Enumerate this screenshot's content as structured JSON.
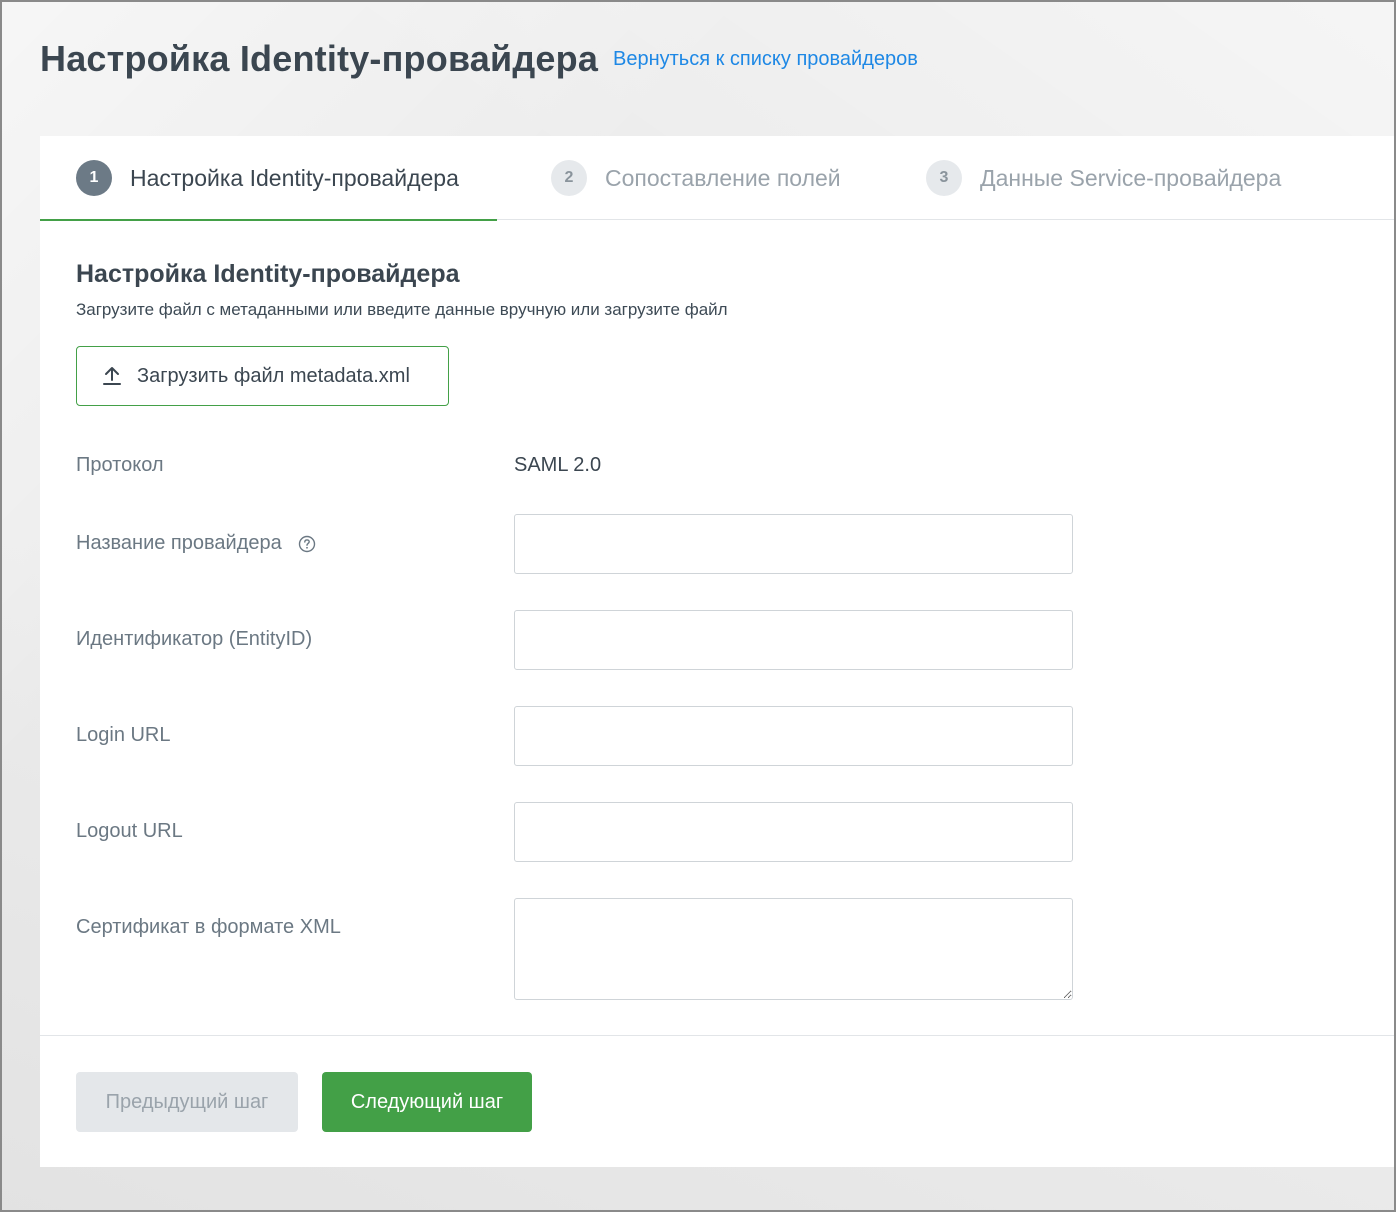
{
  "header": {
    "title": "Настройка Identity-провайдера",
    "back_link": "Вернуться к списку провайдеров"
  },
  "tabs": [
    {
      "num": "1",
      "label": "Настройка Identity-провайдера",
      "active": true
    },
    {
      "num": "2",
      "label": "Сопоставление полей",
      "active": false
    },
    {
      "num": "3",
      "label": "Данные Service-провайдера",
      "active": false
    }
  ],
  "section": {
    "title": "Настройка Identity-провайдера",
    "description": "Загрузите файл с метаданными или введите данные вручную или загрузите файл",
    "upload_label": "Загрузить файл metadata.xml",
    "upload_icon": "upload-icon"
  },
  "form": {
    "protocol_label": "Протокол",
    "protocol_value": "SAML 2.0",
    "provider_name_label": "Название провайдера",
    "provider_name_value": "",
    "help_icon": "help-circle-icon",
    "entity_id_label": "Идентификатор (EntityID)",
    "entity_id_value": "",
    "login_url_label": "Login URL",
    "login_url_value": "",
    "logout_url_label": "Logout URL",
    "logout_url_value": "",
    "certificate_label": "Сертификат в формате XML",
    "certificate_value": ""
  },
  "footer": {
    "prev_label": "Предыдущий шаг",
    "next_label": "Следующий шаг"
  },
  "colors": {
    "accent": "#43a047",
    "link": "#1e88e5",
    "text_dark": "#3b4650",
    "text_muted": "#6b7883"
  }
}
